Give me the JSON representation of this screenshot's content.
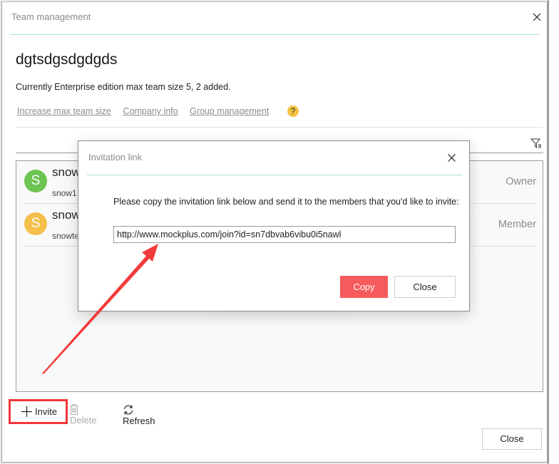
{
  "window": {
    "title": "Team management",
    "close_icon": "close-icon"
  },
  "team": {
    "name": "dgtsdgsdgdgds",
    "edition_text": "Currently Enterprise edition max team size 5, 2 added."
  },
  "links": [
    {
      "label": "Increase max team size"
    },
    {
      "label": "Company info"
    },
    {
      "label": "Group management"
    }
  ],
  "help_icon_glyph": "?",
  "members": [
    {
      "initial": "S",
      "name": "snow",
      "sub": "snow1",
      "role": "Owner",
      "color": "#6cc551"
    },
    {
      "initial": "S",
      "name": "snow",
      "sub": "snowte",
      "role": "Member",
      "color": "#f5bf4b"
    }
  ],
  "toolbar": {
    "invite_label": "Invite",
    "delete_label": "Delete",
    "refresh_label": "Refresh",
    "highlight_color": "#f0373b"
  },
  "footer": {
    "close_label": "Close"
  },
  "modal": {
    "title": "Invitation link",
    "message": "Please copy the invitation link below and send it to the members that you'd like to invite:",
    "link_value": "http://www.mockplus.com/join?id=sn7dbvab6vibu0i5nawl",
    "copy_label": "Copy",
    "close_label": "Close",
    "accent_color": "#f65a5b"
  },
  "annotation": {
    "arrow_color": "#f33a3a"
  }
}
